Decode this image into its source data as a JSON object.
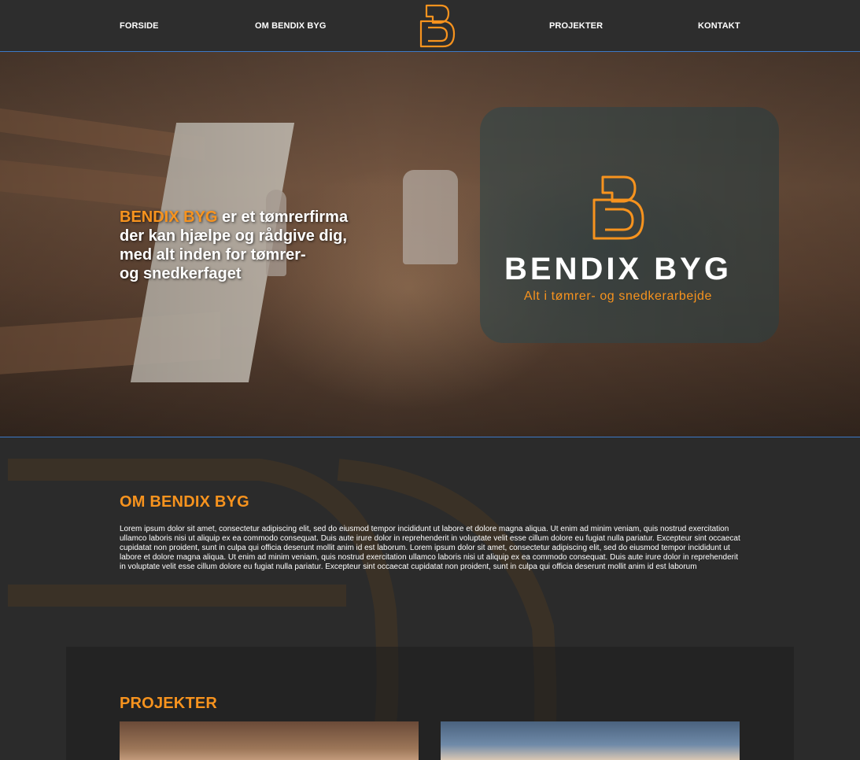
{
  "nav": {
    "items": [
      {
        "label": "FORSIDE"
      },
      {
        "label": "OM BENDIX BYG"
      },
      {
        "label": "PROJEKTER"
      },
      {
        "label": "KONTAKT"
      }
    ],
    "logo_icon": "bendix-b-logo"
  },
  "hero": {
    "brand": "BENDIX BYG",
    "lines": [
      "er et tømrerfirma",
      "der kan hjælpe og rådgive dig,",
      "med alt inden for tømrer-",
      "og snedkerfaget"
    ],
    "logo_name": "BENDIX BYG",
    "logo_tagline": "Alt i tømrer- og snedkerarbejde"
  },
  "about": {
    "title": "OM BENDIX BYG",
    "body": "Lorem ipsum dolor sit amet, consectetur adipiscing elit, sed do eiusmod tempor incididunt ut labore et dolore magna aliqua. Ut enim ad minim veniam, quis nostrud exercitation ullamco laboris nisi ut aliquip ex ea commodo consequat. Duis aute irure dolor in reprehenderit in voluptate velit esse cillum dolore eu fugiat nulla pariatur. Excepteur sint occaecat cupidatat non proident, sunt in culpa qui officia deserunt mollit anim id est laborum. Lorem ipsum dolor sit amet, consectetur adipiscing elit, sed do eiusmod tempor incididunt ut labore et dolore magna aliqua. Ut enim ad minim veniam, quis nostrud exercitation ullamco laboris nisi ut aliquip ex ea commodo consequat. Duis aute irure dolor in reprehenderit in voluptate velit esse cillum dolore eu fugiat nulla pariatur. Excepteur sint occaecat cupidatat non proident, sunt in culpa qui officia deserunt mollit anim id est laborum"
  },
  "projects": {
    "title": "PROJEKTER"
  },
  "colors": {
    "accent": "#f7931e",
    "background": "#2b2b2b",
    "nav_border": "#3d79c7"
  }
}
